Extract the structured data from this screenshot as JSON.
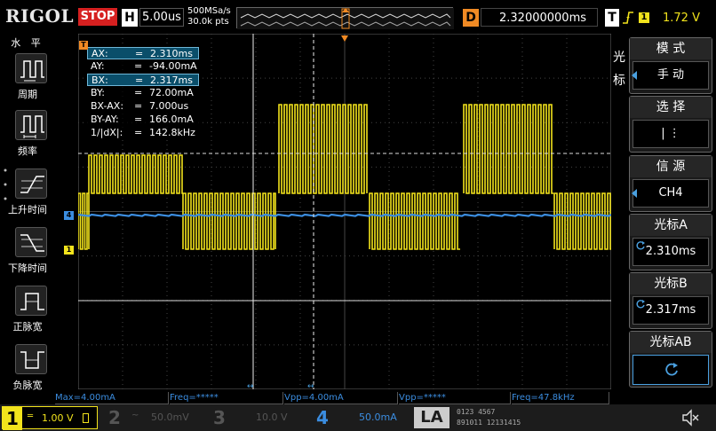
{
  "topbar": {
    "brand": "RIGOL",
    "run_state": "STOP",
    "h_label": "H",
    "h_scale": "5.00us",
    "sample_rate": "500MSa/s",
    "memory_depth": "30.0k pts",
    "d_label": "D",
    "delay": "2.32000000ms",
    "t_label": "T",
    "trigger_source": "1",
    "trigger_level": "1.72 V"
  },
  "left_menu": {
    "title": "水 平",
    "items": [
      {
        "label": "周期",
        "icon": "period-icon"
      },
      {
        "label": "频率",
        "icon": "frequency-icon"
      },
      {
        "label": "上升时间",
        "icon": "rise-time-icon"
      },
      {
        "label": "下降时间",
        "icon": "fall-time-icon"
      },
      {
        "label": "正脉宽",
        "icon": "positive-width-icon"
      },
      {
        "label": "负脉宽",
        "icon": "negative-width-icon"
      }
    ]
  },
  "cursor_readout": {
    "rows": [
      {
        "label": "AX:",
        "value": "2.310ms",
        "highlight": true
      },
      {
        "label": "AY:",
        "value": "-94.00mA",
        "highlight": false
      },
      {
        "label": "BX:",
        "value": "2.317ms",
        "highlight": true
      },
      {
        "label": "BY:",
        "value": "72.00mA",
        "highlight": false
      },
      {
        "label": "BX-AX:",
        "value": "7.000us",
        "highlight": false
      },
      {
        "label": "BY-AY:",
        "value": "166.0mA",
        "highlight": false
      },
      {
        "label": "1/|dX|:",
        "value": "142.8kHz",
        "highlight": false
      }
    ]
  },
  "screen_markers": {
    "ch1_marker": "1",
    "ch4_marker": "4",
    "trigger_marker": "T"
  },
  "right_menu": {
    "title": "光标",
    "mode_title": "模 式",
    "mode_value": "手 动",
    "select_title": "选 择",
    "select_value": "| ⋮",
    "source_title": "信 源",
    "source_value": "CH4",
    "cursor_a_title": "光标A",
    "cursor_a_value": "2.310ms",
    "cursor_b_title": "光标B",
    "cursor_b_value": "2.317ms",
    "cursor_ab_title": "光标AB"
  },
  "measurements": [
    {
      "text": "Max=4.00mA"
    },
    {
      "text": "Freq=*****"
    },
    {
      "text": "Vpp=4.00mA"
    },
    {
      "text": "Vpp=*****"
    },
    {
      "text": "Freq=47.8kHz"
    }
  ],
  "channels": [
    {
      "num": "1",
      "coupling": "═",
      "scale": "1.00 V",
      "color": "#f2e31c",
      "active": true
    },
    {
      "num": "2",
      "coupling": "~",
      "scale": "50.0mV",
      "color": "#555555",
      "active": false
    },
    {
      "num": "3",
      "coupling": "",
      "scale": "10.0 V",
      "color": "#555555",
      "active": false
    },
    {
      "num": "4",
      "coupling": "",
      "scale": "50.0mA",
      "color": "#3b8de0",
      "active": true
    }
  ],
  "la": {
    "label": "LA",
    "row1": "0123 4567",
    "row2": "891011 12131415"
  },
  "colors": {
    "ch1": "#f2e31c",
    "ch4": "#3b8de0",
    "trigger": "#f08a24",
    "stop": "#d62020"
  }
}
